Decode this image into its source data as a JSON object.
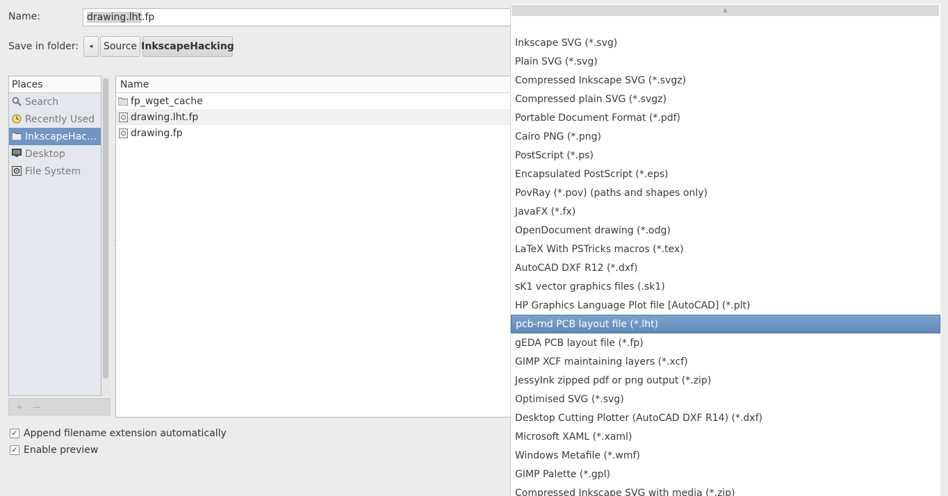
{
  "name_row": {
    "label": "Name:",
    "value_selected": "drawing.lht",
    "value_rest": ".fp"
  },
  "folder_row": {
    "label": "Save in folder:",
    "back_arrow": "◂",
    "crumbs": [
      "Source",
      "InkscapeHacking"
    ]
  },
  "places": {
    "header": "Places",
    "items": [
      {
        "label": "Search",
        "icon": "search-icon"
      },
      {
        "label": "Recently Used",
        "icon": "clock-icon"
      },
      {
        "label": "InkscapeHac…",
        "icon": "folder-icon",
        "active": true
      },
      {
        "label": "Desktop",
        "icon": "desktop-icon"
      },
      {
        "label": "File System",
        "icon": "drive-icon"
      }
    ],
    "add_glyph": "+",
    "remove_glyph": "—"
  },
  "files": {
    "header": "Name",
    "rows": [
      {
        "name": "fp_wget_cache",
        "icon": "folder-icon"
      },
      {
        "name": "drawing.lht.fp",
        "icon": "file-icon"
      },
      {
        "name": "drawing.fp",
        "icon": "file-icon"
      }
    ]
  },
  "options": {
    "append_ext": "Append filename extension automatically",
    "enable_preview": "Enable preview"
  },
  "dropdown": {
    "scroll_up_glyph": "▲",
    "items": [
      "Inkscape SVG (*.svg)",
      "Plain SVG (*.svg)",
      "Compressed Inkscape SVG (*.svgz)",
      "Compressed plain SVG (*.svgz)",
      "Portable Document Format (*.pdf)",
      "Cairo PNG (*.png)",
      "PostScript (*.ps)",
      "Encapsulated PostScript (*.eps)",
      "PovRay (*.pov) (paths and shapes only)",
      "JavaFX (*.fx)",
      "OpenDocument drawing (*.odg)",
      "LaTeX With PSTricks macros (*.tex)",
      "AutoCAD DXF R12 (*.dxf)",
      "sK1 vector graphics files (.sk1)",
      "HP Graphics Language Plot file [AutoCAD] (*.plt)",
      "pcb-rnd PCB layout file (*.lht)",
      "gEDA PCB layout file (*.fp)",
      "GIMP XCF maintaining layers (*.xcf)",
      "JessyInk zipped pdf or png output (*.zip)",
      "Optimised SVG (*.svg)",
      "Desktop Cutting Plotter (AutoCAD DXF R14) (*.dxf)",
      "Microsoft XAML (*.xaml)",
      "Windows Metafile (*.wmf)",
      "GIMP Palette (*.gpl)",
      "Compressed Inkscape SVG with media (*.zip)"
    ],
    "selected_index": 15
  }
}
